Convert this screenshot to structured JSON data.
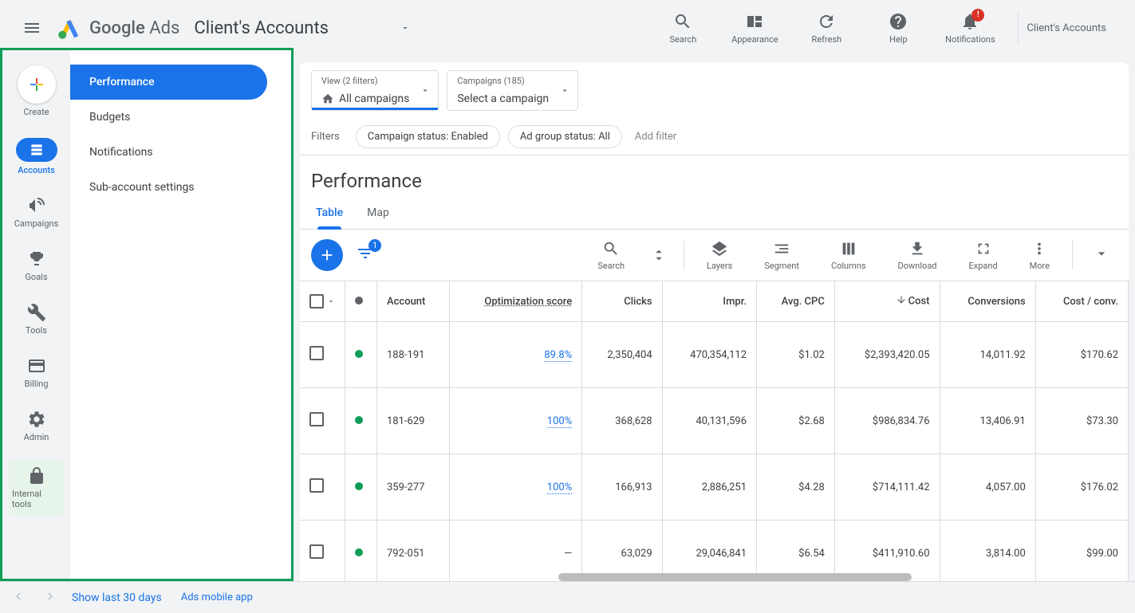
{
  "header": {
    "brand1": "Google",
    "brand2": "Ads",
    "accountName": "Client's Accounts",
    "icons": {
      "search": "Search",
      "appearance": "Appearance",
      "refresh": "Refresh",
      "help": "Help",
      "notifications": "Notifications"
    },
    "notif_badge": "!",
    "rightAccount": "Client's Accounts"
  },
  "navRail": {
    "create": "Create",
    "accounts": "Accounts",
    "campaigns": "Campaigns",
    "goals": "Goals",
    "tools": "Tools",
    "billing": "Billing",
    "admin": "Admin",
    "internal": "Internal tools"
  },
  "secondaryNav": {
    "performance": "Performance",
    "budgets": "Budgets",
    "notifications": "Notifications",
    "subaccount": "Sub-account settings"
  },
  "viewSelect": {
    "top": "View (2 filters)",
    "bottom": "All campaigns"
  },
  "campaignSelect": {
    "top": "Campaigns (185)",
    "bottom": "Select a campaign"
  },
  "filtersRow": {
    "label": "Filters",
    "chip1": "Campaign status: Enabled",
    "chip2": "Ad group status: All",
    "addFilter": "Add filter"
  },
  "pageTitle": "Performance",
  "tabs": {
    "table": "Table",
    "map": "Map"
  },
  "filterCount": "1",
  "toolbar": {
    "search": "Search",
    "layers": "Layers",
    "segment": "Segment",
    "columns": "Columns",
    "download": "Download",
    "expand": "Expand",
    "more": "More"
  },
  "columns": {
    "account": "Account",
    "optScore": "Optimization score",
    "clicks": "Clicks",
    "impr": "Impr.",
    "avgCpc": "Avg. CPC",
    "cost": "Cost",
    "conversions": "Conversions",
    "costConv": "Cost / conv."
  },
  "rows": [
    {
      "account": "188-191",
      "opt": "89.8%",
      "clicks": "2,350,404",
      "impr": "470,354,112",
      "cpc": "$1.02",
      "cost": "$2,393,420.05",
      "conv": "14,011.92",
      "cc": "$170.62"
    },
    {
      "account": "181-629",
      "opt": "100%",
      "clicks": "368,628",
      "impr": "40,131,596",
      "cpc": "$2.68",
      "cost": "$986,834.76",
      "conv": "13,406.91",
      "cc": "$73.30"
    },
    {
      "account": "359-277",
      "opt": "100%",
      "clicks": "166,913",
      "impr": "2,886,251",
      "cpc": "$4.28",
      "cost": "$714,111.42",
      "conv": "4,057.00",
      "cc": "$176.02"
    },
    {
      "account": "792-051",
      "opt": "—",
      "clicks": "63,029",
      "impr": "29,046,841",
      "cpc": "$6.54",
      "cost": "$411,910.60",
      "conv": "3,814.00",
      "cc": "$99.00"
    }
  ],
  "footer": {
    "show30": "Show last 30 days",
    "mobile": "Ads mobile app"
  }
}
